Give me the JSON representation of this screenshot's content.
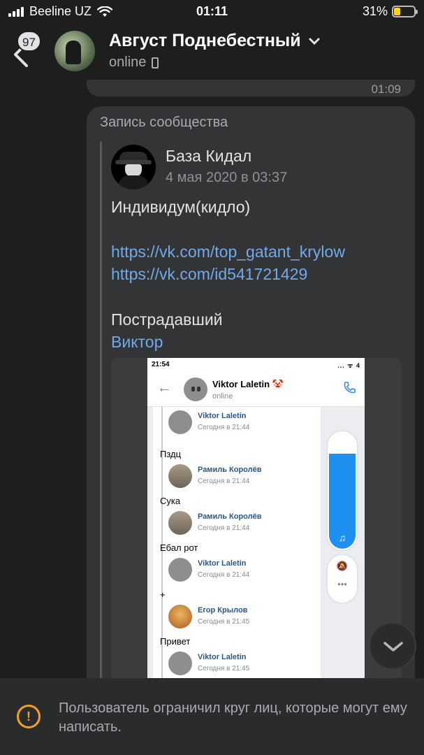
{
  "status_bar": {
    "carrier": "Beeline UZ",
    "time": "01:11",
    "battery": "31%",
    "battery_level": 0.31
  },
  "header": {
    "unread_count": "97",
    "name": "Август Поднебестный",
    "status": "online"
  },
  "chat": {
    "prev_message_time": "01:09",
    "repost": {
      "label": "Запись сообщества",
      "author": "База Кидал",
      "date": "4 мая 2020 в 03:37",
      "line1": "Индивидум(кидло)",
      "link1": "https://vk.com/top_gatant_krylow",
      "link2": "https://vk.com/id541721429",
      "line2": "Пострадавший",
      "victim_link": "Виктор"
    }
  },
  "embedded_screenshot": {
    "time": "21:54",
    "status_icons": "... ᯤ 4",
    "contact": "Viktor Laletin 🤡",
    "contact_status": "online",
    "volume_level": 0.82,
    "messages": [
      {
        "author": "Viktor Laletin",
        "time": "Сегодня в 21:44",
        "text": "Пздц"
      },
      {
        "author": "Рамиль Королёв",
        "time": "Сегодня в 21:44",
        "text": "Сука"
      },
      {
        "author": "Рамиль Королёв",
        "time": "Сегодня в 21:44",
        "text": "Ебал рот"
      },
      {
        "author": "Viktor Laletin",
        "time": "Сегодня в 21:44",
        "text": "+"
      },
      {
        "author": "Егор Крылов",
        "time": "Сегодня в 21:45",
        "text": "Привет"
      },
      {
        "author": "Viktor Laletin",
        "time": "Сегодня в 21:45",
        "text": ""
      }
    ]
  },
  "notice": {
    "text": "Пользователь ограничил круг лиц, которые могут ему написать."
  },
  "colors": {
    "background": "#1e1e1e",
    "bubble": "#333436",
    "link": "#71aaeb",
    "warning": "#f2a126"
  }
}
